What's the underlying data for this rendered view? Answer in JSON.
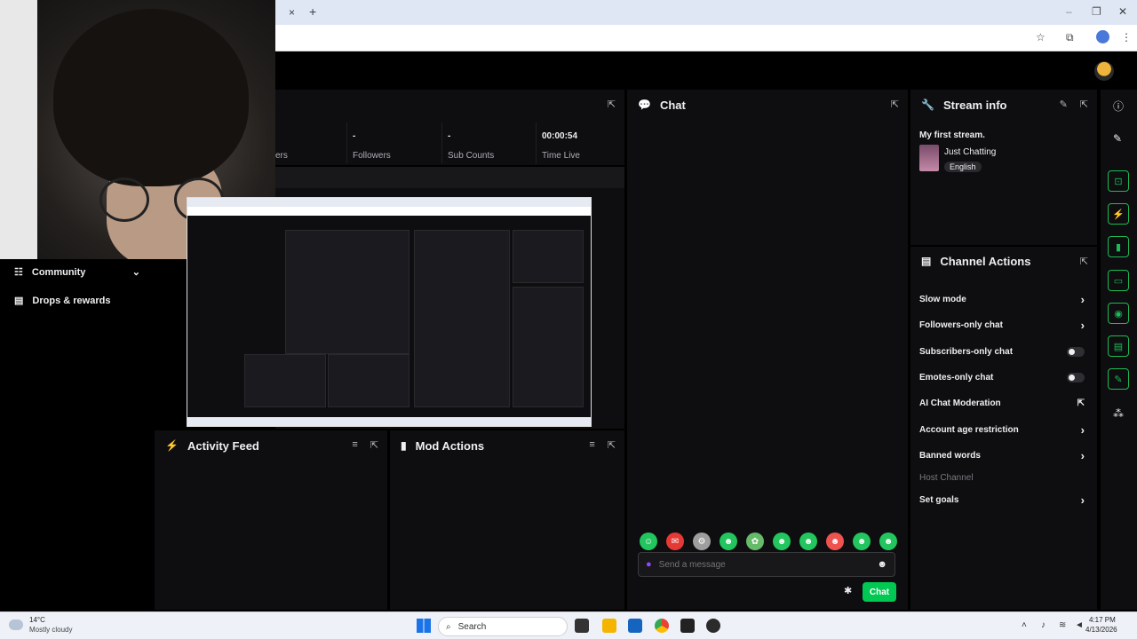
{
  "browser": {
    "tab_close": "×",
    "new_tab": "+",
    "window_controls": [
      "–",
      "❐",
      "✕"
    ]
  },
  "stats": {
    "partial_label": "ers",
    "items": [
      {
        "value": "-",
        "label": "Followers"
      },
      {
        "value": "-",
        "label": "Sub Counts"
      },
      {
        "value": "00:00:54",
        "label": "Time Live"
      }
    ]
  },
  "left_nav": {
    "items": [
      {
        "label": "Community",
        "icon": "community-icon",
        "chevron": "⌄"
      },
      {
        "label": "Drops & rewards",
        "icon": "drops-icon"
      }
    ]
  },
  "panels": {
    "activity_feed": "Activity Feed",
    "mod_actions": "Mod Actions",
    "chat": "Chat",
    "stream_info": "Stream info",
    "channel_actions": "Channel Actions"
  },
  "stream_info": {
    "title": "My first stream.",
    "category": "Just Chatting",
    "language": "English"
  },
  "chat": {
    "placeholder": "Send a message",
    "button": "Chat",
    "emotes": [
      "☺",
      "✉",
      "⚙",
      "☻",
      "✿",
      "☻",
      "☻",
      "☻",
      "☻",
      "☻"
    ]
  },
  "channel_actions": [
    {
      "label": "Slow mode",
      "control": "chevron"
    },
    {
      "label": "Followers-only chat",
      "control": "chevron"
    },
    {
      "label": "Subscribers-only chat",
      "control": "toggle"
    },
    {
      "label": "Emotes-only chat",
      "control": "toggle"
    },
    {
      "label": "AI Chat Moderation",
      "control": "external"
    },
    {
      "label": "Account age restriction",
      "control": "chevron"
    },
    {
      "label": "Banned words",
      "control": "chevron"
    },
    {
      "label": "Host Channel",
      "control": "none"
    },
    {
      "label": "Set goals",
      "control": "chevron"
    }
  ],
  "taskbar": {
    "weather_temp": "14°C",
    "weather_desc": "Mostly cloudy",
    "search": "Search",
    "time": "4:17 PM",
    "date": "4/13/2026"
  },
  "colors": {
    "accent_green": "#00c853",
    "panel_bg": "#0e0e10",
    "text": "#efeff1"
  }
}
